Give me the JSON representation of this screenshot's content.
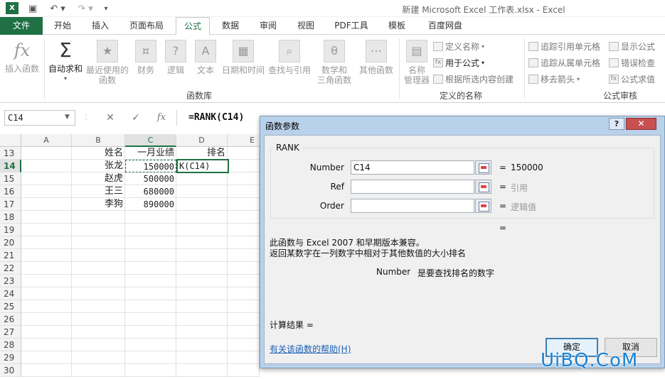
{
  "window_title": "新建 Microsoft Excel 工作表.xlsx - Excel",
  "tabs": [
    "文件",
    "开始",
    "插入",
    "页面布局",
    "公式",
    "数据",
    "审阅",
    "视图",
    "PDF工具",
    "模板",
    "百度网盘"
  ],
  "ribbon": {
    "insert_function": "插入函数",
    "autosum": "自动求和",
    "recent": [
      "最近使用的",
      "函数"
    ],
    "finance": "财务",
    "logic": "逻辑",
    "text": "文本",
    "datetime": "日期和时间",
    "lookup": "查找与引用",
    "math": [
      "数学和",
      "三角函数"
    ],
    "other": "其他函数",
    "group_library": "函数库",
    "name_manager": [
      "名称",
      "管理器"
    ],
    "define_name": "定义名称",
    "use_in_formula": "用于公式",
    "create_from_selection": "根据所选内容创建",
    "group_names": "定义的名称",
    "trace_precedents": "追踪引用单元格",
    "trace_dependents": "追踪从属单元格",
    "remove_arrows": "移去箭头",
    "show_formulas": "显示公式",
    "error_checking": "错误检查",
    "evaluate": "公式求值",
    "group_audit": "公式审核"
  },
  "formula_bar": {
    "name_box": "C14",
    "cancel": "✕",
    "enter": "✓",
    "fx": "fx",
    "formula": "=RANK(C14)"
  },
  "sheet": {
    "columns": [
      "A",
      "B",
      "C",
      "D",
      "E"
    ],
    "rows": [
      "13",
      "14",
      "15",
      "16",
      "17",
      "18",
      "19",
      "20",
      "21",
      "22",
      "23",
      "24",
      "25",
      "26",
      "27",
      "28",
      "29",
      "30"
    ],
    "header": {
      "name": "姓名",
      "sales": "一月业绩",
      "rank": "排名"
    },
    "data": [
      {
        "name": "张龙",
        "sales": "150000",
        "rank": "K(C14)"
      },
      {
        "name": "赵虎",
        "sales": "500000"
      },
      {
        "name": "王三",
        "sales": "680000"
      },
      {
        "name": "李狗",
        "sales": "890000"
      }
    ]
  },
  "dialog": {
    "title": "函数参数",
    "help_button": "?",
    "close_button": "✕",
    "function_name": "RANK",
    "args": [
      {
        "label": "Number",
        "value": "C14",
        "result": "150000"
      },
      {
        "label": "Ref",
        "value": "",
        "result": "引用"
      },
      {
        "label": "Order",
        "value": "",
        "result": "逻辑值"
      }
    ],
    "equals": "=",
    "compat_note": "此函数与 Excel 2007 和早期版本兼容。",
    "description": "返回某数字在一列数字中相对于其他数值的大小排名",
    "arg_help_name": "Number",
    "arg_help_text": "是要查找排名的数字",
    "result_label": "计算结果 =",
    "help_link": "有关该函数的帮助(H)",
    "ok": "确定",
    "cancel": "取消"
  },
  "watermark": "UiBQ.CoM",
  "colors": {
    "accent": "#1f7145",
    "dialog_frame": "#b9d1ea",
    "link": "#1a5fb4"
  }
}
